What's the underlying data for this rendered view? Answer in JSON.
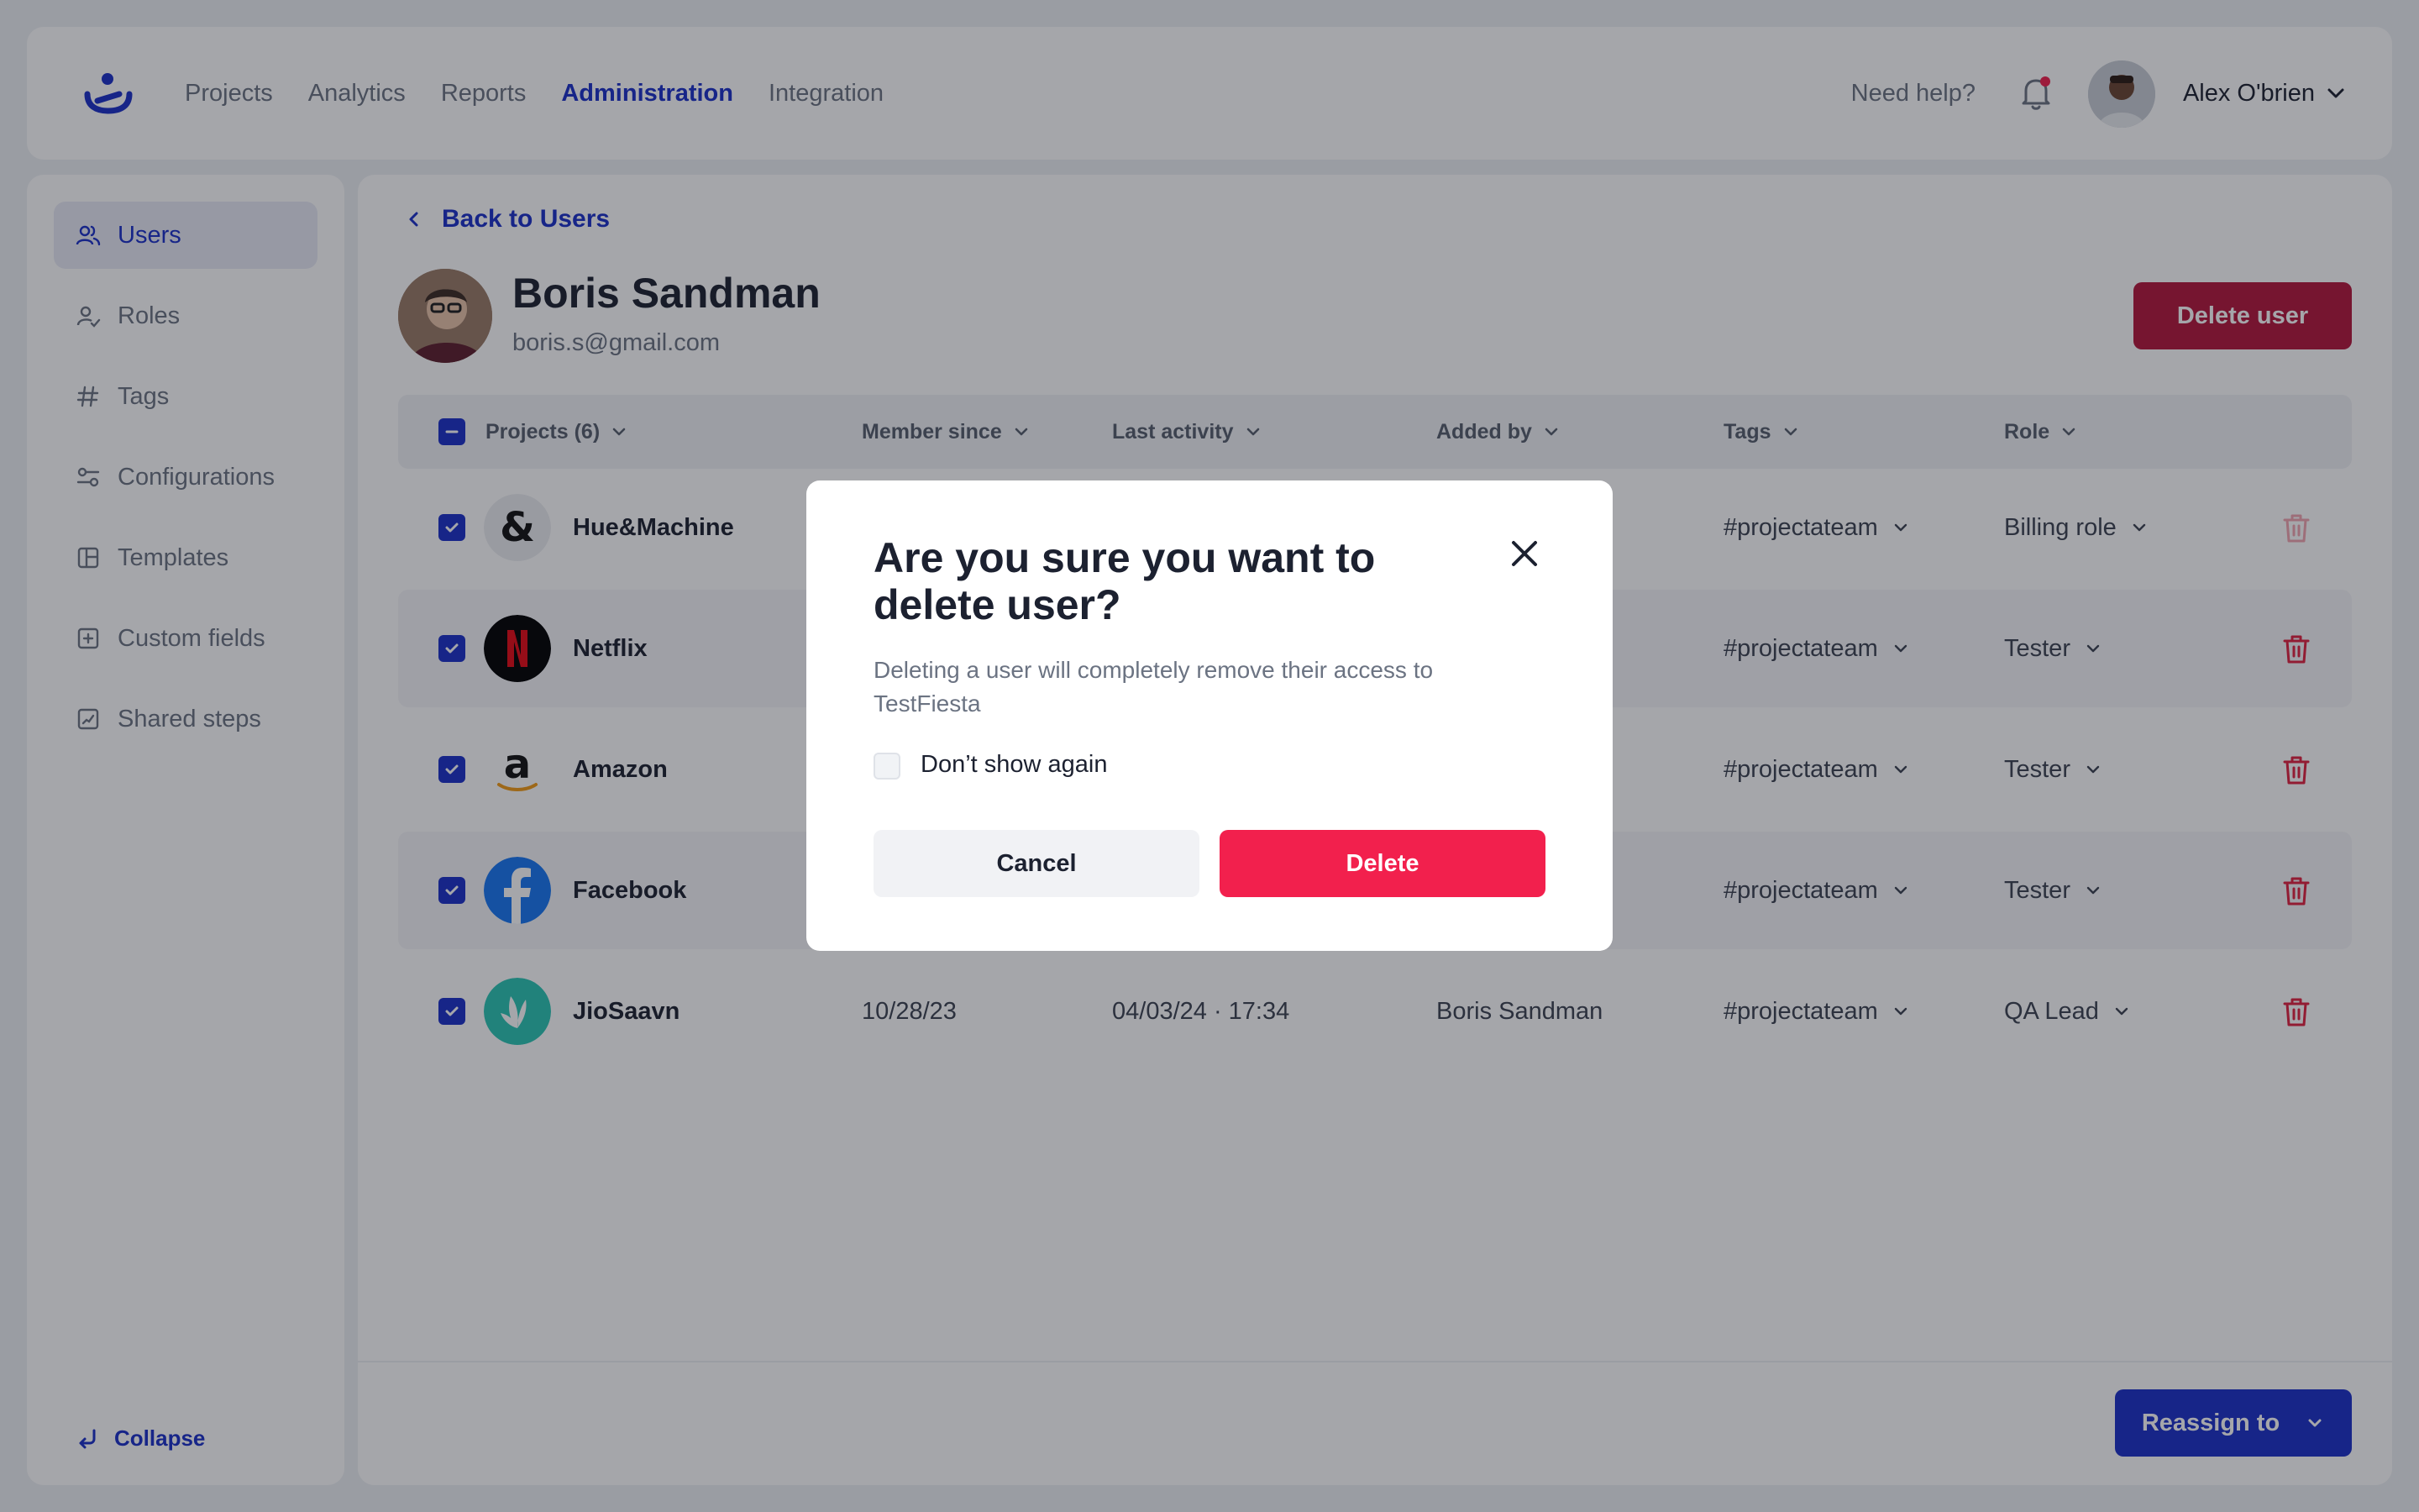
{
  "header": {
    "nav": [
      "Projects",
      "Analytics",
      "Reports",
      "Administration",
      "Integration"
    ],
    "help": "Need help?",
    "user_name": "Alex O'brien"
  },
  "sidebar": {
    "items": [
      {
        "label": "Users",
        "icon": "users-icon"
      },
      {
        "label": "Roles",
        "icon": "role-icon"
      },
      {
        "label": "Tags",
        "icon": "hash-icon"
      },
      {
        "label": "Configurations",
        "icon": "sliders-icon"
      },
      {
        "label": "Templates",
        "icon": "template-icon"
      },
      {
        "label": "Custom fields",
        "icon": "plus-square-icon"
      },
      {
        "label": "Shared steps",
        "icon": "shared-steps-icon"
      }
    ],
    "collapse": "Collapse"
  },
  "main": {
    "back": "Back to Users",
    "user_name": "Boris Sandman",
    "user_email": "boris.s@gmail.com",
    "delete_user": "Delete user",
    "columns": [
      "Projects (6)",
      "Member since",
      "Last activity",
      "Added by",
      "Tags",
      "Role"
    ],
    "rows": [
      {
        "project": "Hue&Machine",
        "member_since": "",
        "last_activity": "",
        "added_by": "",
        "tag": "#projectateam",
        "role": "Billing role"
      },
      {
        "project": "Netflix",
        "member_since": "",
        "last_activity": "",
        "added_by": "",
        "tag": "#projectateam",
        "role": "Tester"
      },
      {
        "project": "Amazon",
        "member_since": "",
        "last_activity": "",
        "added_by": "",
        "tag": "#projectateam",
        "role": "Tester"
      },
      {
        "project": "Facebook",
        "member_since": "",
        "last_activity": "",
        "added_by": "",
        "tag": "#projectateam",
        "role": "Tester"
      },
      {
        "project": "JioSaavn",
        "member_since": "10/28/23",
        "last_activity": "04/03/24 · 17:34",
        "added_by": "Boris Sandman",
        "tag": "#projectateam",
        "role": "QA Lead"
      }
    ],
    "reassign": "Reassign to"
  },
  "modal": {
    "title": "Are you sure you want to delete user?",
    "text": "Deleting a user will completely remove their access to TestFiesta",
    "checkbox_label": "Don’t show again",
    "cancel": "Cancel",
    "delete": "Delete"
  },
  "colors": {
    "accent": "#1a2fc9",
    "danger": "#f2204d",
    "danger_dark": "#b3163a"
  }
}
